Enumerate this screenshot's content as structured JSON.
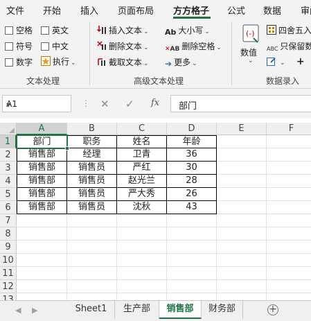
{
  "ribbon_tabs": [
    "文件",
    "开始",
    "插入",
    "页面布局",
    "方方格子",
    "公式",
    "数据",
    "审阅"
  ],
  "active_tab": "方方格子",
  "ribbon": {
    "text_group": {
      "label": "文本处理",
      "checkboxes": [
        "空格",
        "英文",
        "符号",
        "中文",
        "数字"
      ],
      "execute_label": "执行"
    },
    "advanced_group": {
      "label": "高级文本处理",
      "insert_text": "插入文本",
      "delete_text": "删除文本",
      "extract_text": "截取文本",
      "case_label": "大小写",
      "delete_space": "删除空格",
      "more": "更多"
    },
    "entry_group": {
      "label": "数据录入",
      "value_label": "数值",
      "round_label": "四舍五入",
      "keep_label": "只保留数"
    }
  },
  "formula_bar": {
    "name_box": "A1",
    "content": "部门"
  },
  "columns": [
    "A",
    "B",
    "C",
    "D",
    "E",
    "F"
  ],
  "rows": [
    "1",
    "2",
    "3",
    "4",
    "5",
    "6",
    "7",
    "8",
    "9",
    "10",
    "11",
    "12",
    "13"
  ],
  "table": {
    "header": [
      "部门",
      "职务",
      "姓名",
      "年龄"
    ],
    "body": [
      [
        "销售部",
        "经理",
        "卫青",
        "36"
      ],
      [
        "销售部",
        "销售员",
        "严红",
        "30"
      ],
      [
        "销售部",
        "销售员",
        "赵光兰",
        "28"
      ],
      [
        "销售部",
        "销售员",
        "严大秀",
        "26"
      ],
      [
        "销售部",
        "销售员",
        "沈秋",
        "43"
      ]
    ]
  },
  "sheets": [
    "Sheet1",
    "生产部",
    "销售部",
    "财务部"
  ],
  "active_sheet": "销售部",
  "colors": {
    "accent": "#217346",
    "ribbon_bg": "#f3f3f3",
    "delete_icon": "#c00000"
  }
}
